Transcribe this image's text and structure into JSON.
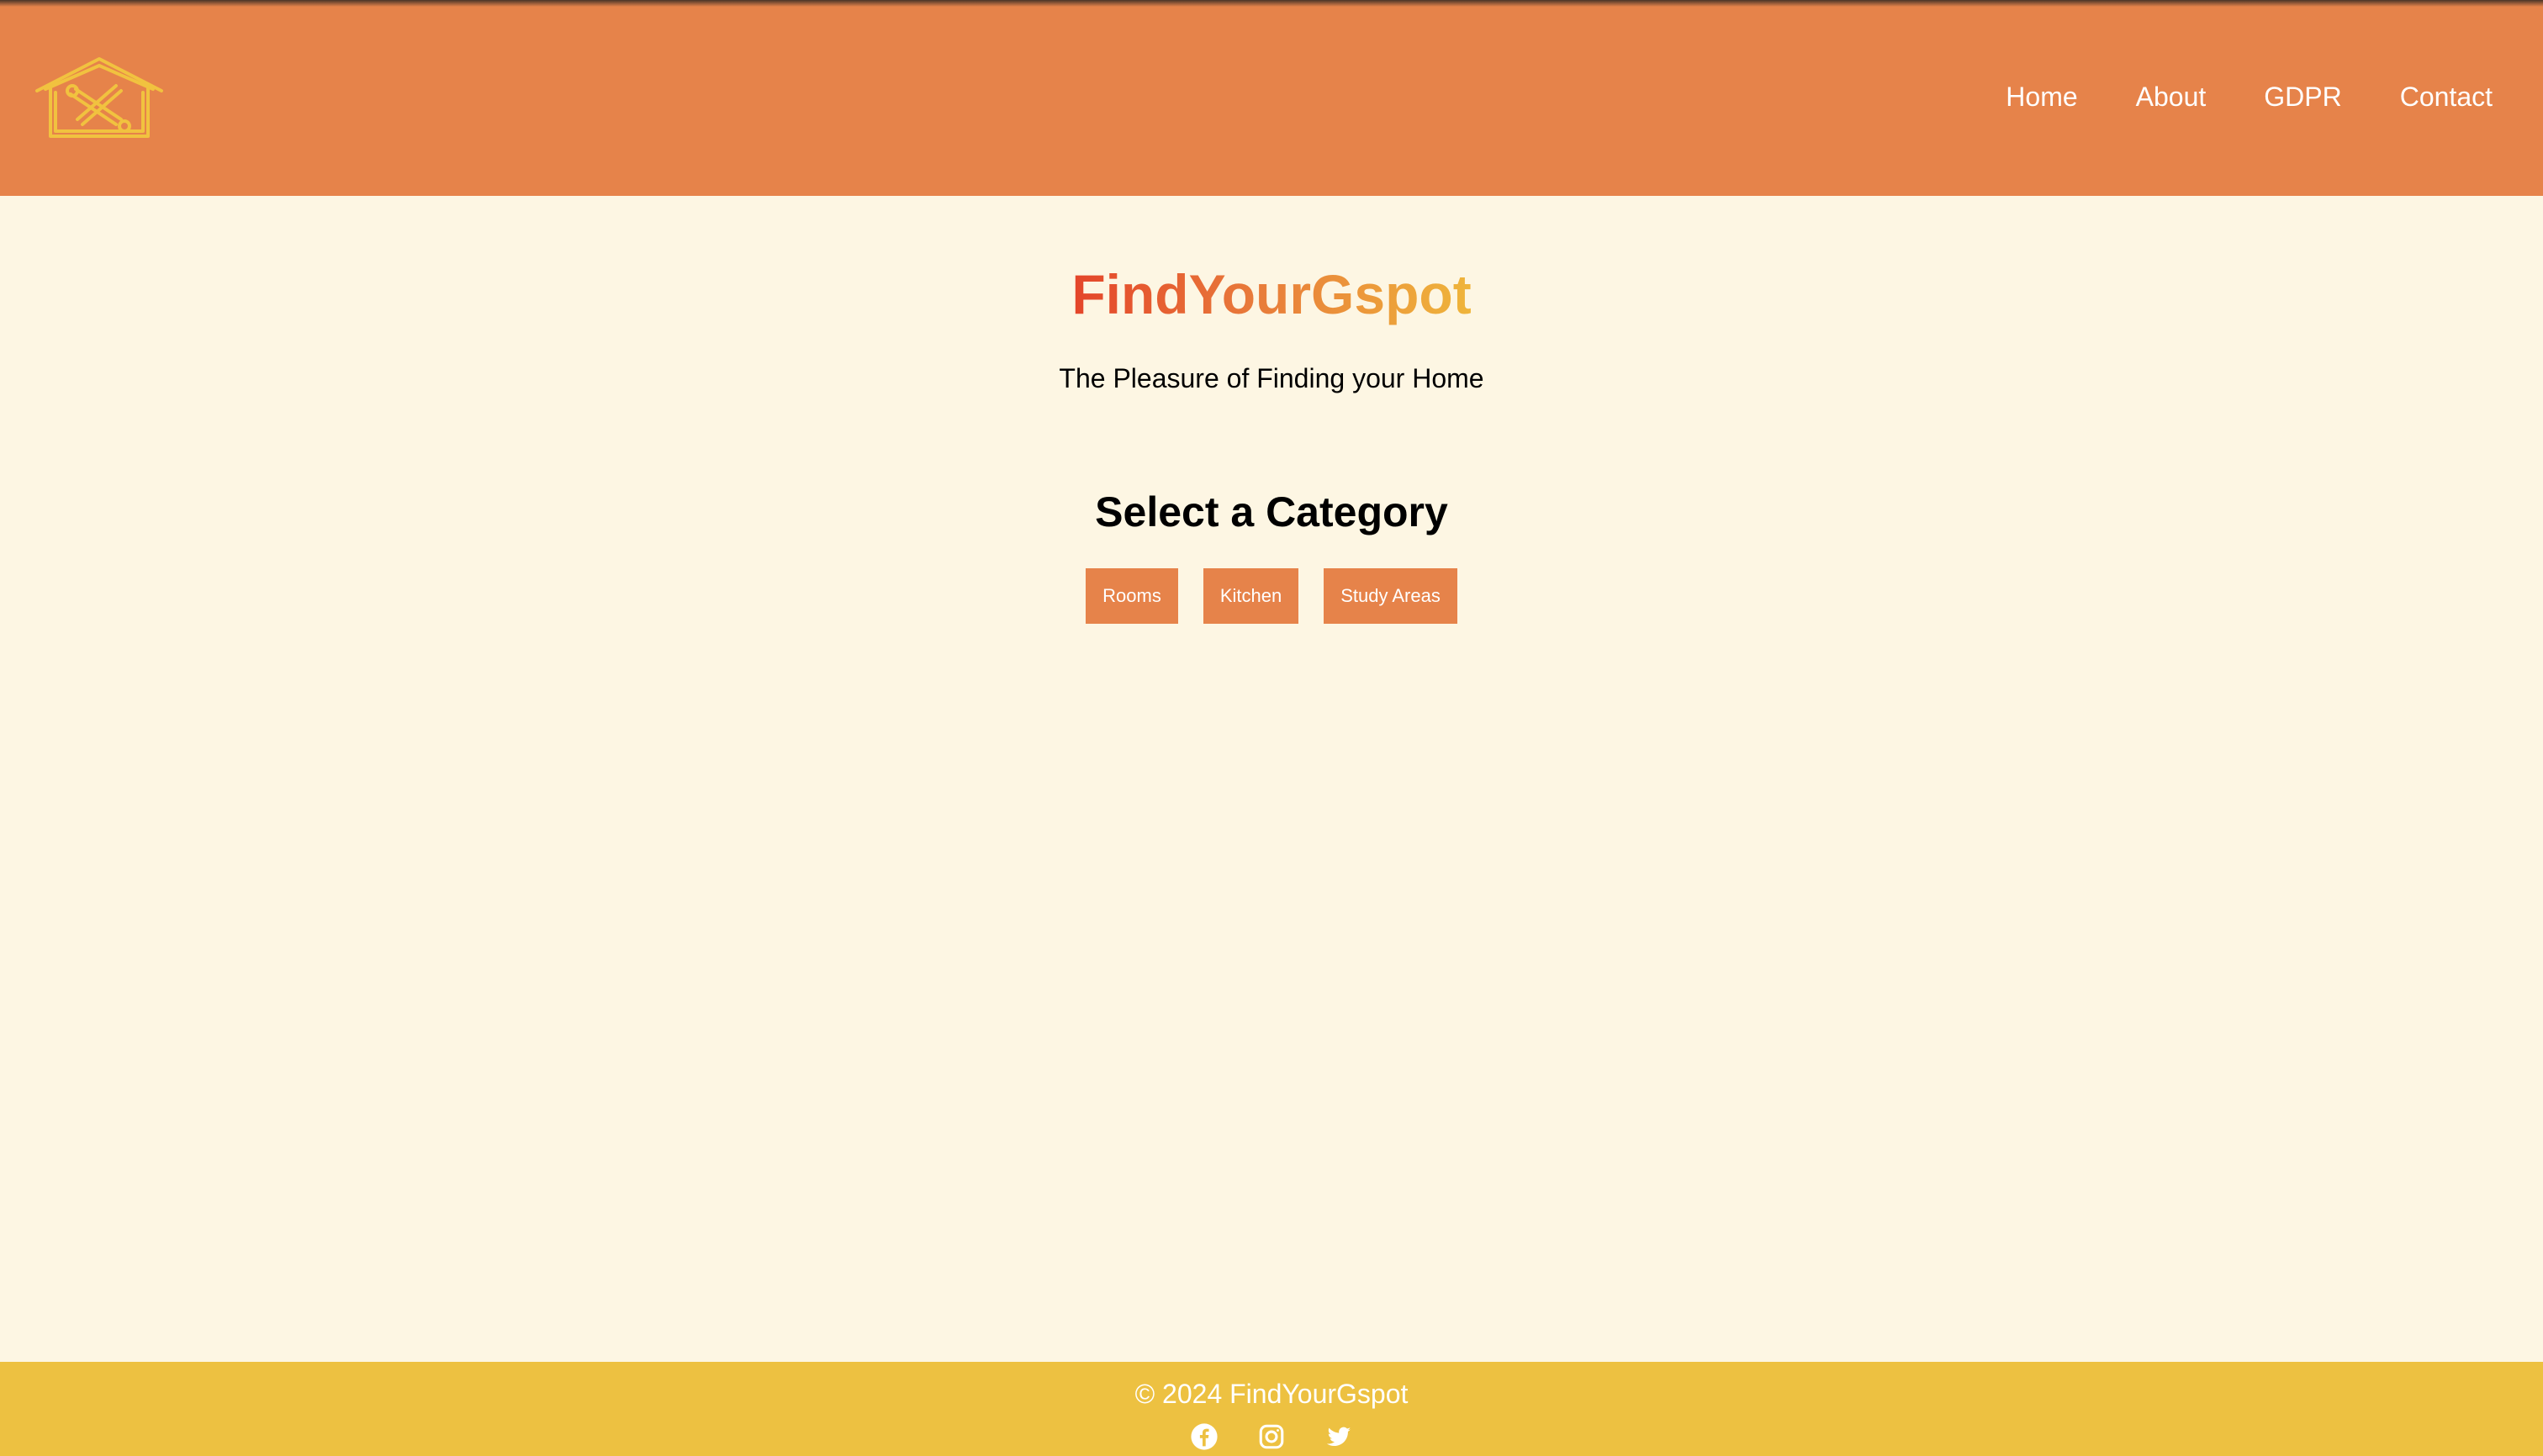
{
  "header": {
    "logo_icon": "house-tools-icon",
    "nav": [
      {
        "label": "Home"
      },
      {
        "label": "About"
      },
      {
        "label": "GDPR"
      },
      {
        "label": "Contact"
      }
    ]
  },
  "main": {
    "brand_title": "FindYourGspot",
    "tagline": "The Pleasure of Finding your Home",
    "category_heading": "Select a Category",
    "categories": [
      {
        "label": "Rooms"
      },
      {
        "label": "Kitchen"
      },
      {
        "label": "Study Areas"
      }
    ]
  },
  "footer": {
    "copyright": "© 2024 FindYourGspot",
    "social_icons": [
      "facebook-icon",
      "instagram-icon",
      "twitter-icon"
    ]
  },
  "colors": {
    "header_bg": "#e6834a",
    "page_bg": "#fdf6e3",
    "footer_bg": "#edc141",
    "button_bg": "#e6834a",
    "logo_stroke": "#f1c23f",
    "brand_gradient": [
      "#e4452a",
      "#e87a3a",
      "#efb53b"
    ]
  }
}
